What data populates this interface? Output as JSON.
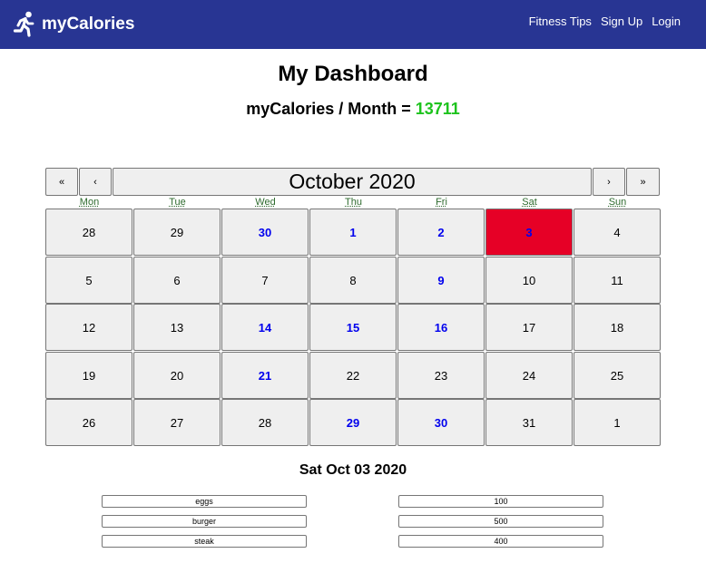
{
  "nav": {
    "brand": "myCalories",
    "links": [
      "Fitness Tips",
      "Sign Up",
      "Login"
    ]
  },
  "dashboard": {
    "title": "My Dashboard",
    "monthly_label": "myCalories / Month = ",
    "monthly_value": "13711"
  },
  "calendar": {
    "prev_year": "«",
    "prev_month": "‹",
    "month_label": "October 2020",
    "next_month": "›",
    "next_year": "»",
    "weekdays": [
      "Mon",
      "Tue",
      "Wed",
      "Thu",
      "Fri",
      "Sat",
      "Sun"
    ],
    "weeks": [
      [
        "28",
        "29",
        "30",
        "1",
        "2",
        "3",
        "4"
      ],
      [
        "5",
        "6",
        "7",
        "8",
        "9",
        "10",
        "11"
      ],
      [
        "12",
        "13",
        "14",
        "15",
        "16",
        "17",
        "18"
      ],
      [
        "19",
        "20",
        "21",
        "22",
        "23",
        "24",
        "25"
      ],
      [
        "26",
        "27",
        "28",
        "29",
        "30",
        "31",
        "1"
      ]
    ],
    "logged_days": [
      "30",
      "1",
      "2",
      "3",
      "9",
      "14",
      "15",
      "16",
      "21",
      "29"
    ],
    "selected_day": "3",
    "colors": {
      "logged": "#0000ee",
      "selected": "#e60026",
      "accent_green": "#1ec31e",
      "navbar": "#283593"
    }
  },
  "selection": {
    "date": "Sat Oct 03 2020",
    "entries": [
      {
        "food": "eggs",
        "calories": "100"
      },
      {
        "food": "burger",
        "calories": "500"
      },
      {
        "food": "steak",
        "calories": "400"
      }
    ]
  }
}
